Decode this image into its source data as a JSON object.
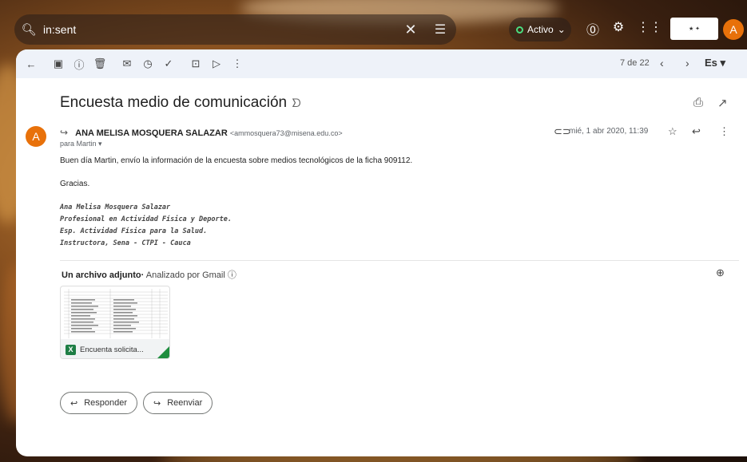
{
  "search": {
    "query": "in:sent"
  },
  "status": {
    "label": "Activo"
  },
  "toolbar": {
    "pager": "7 de 22",
    "lang": "Es"
  },
  "email": {
    "subject": "Encuesta medio de comunicación",
    "sender_name": "ANA MELISA MOSQUERA SALAZAR",
    "sender_email": "<ammosquera73@misena.edu.co>",
    "to": "para Martin",
    "date": "mié, 1 abr 2020, 11:39",
    "greeting": "Buen día Martin, envío la información de la encuesta sobre medios tecnológicos de la ficha 909112.",
    "thanks": "Gracias.",
    "signature": [
      "Ana Melisa Mosquera Salazar",
      "Profesional en Actividad Física y Deporte.",
      "Esp. Actividad Física para la Salud.",
      "Instructora, Sena - CTPI - Cauca"
    ]
  },
  "attachments": {
    "title": "Un archivo adjunto",
    "scanned": "Analizado por Gmail",
    "file_name": "Encuenta solicita..."
  },
  "actions": {
    "reply": "Responder",
    "forward": "Reenviar"
  },
  "avatar_letter": "A",
  "colors": {
    "accent": "#e8710a",
    "excel": "#1e7e45"
  }
}
